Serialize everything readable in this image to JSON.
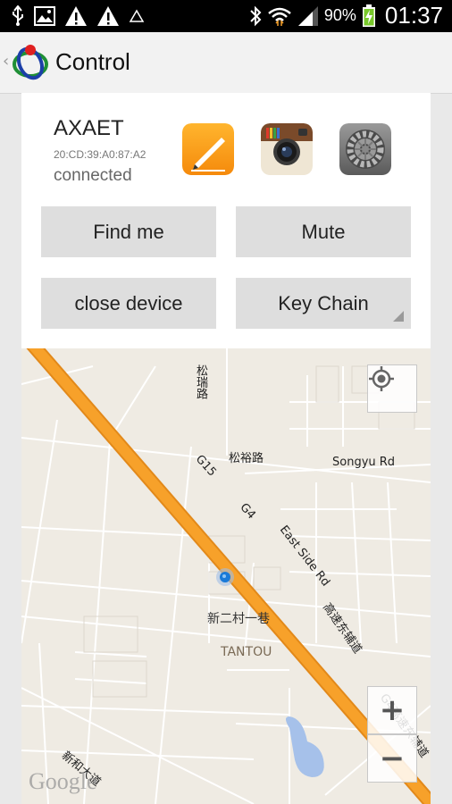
{
  "status_bar": {
    "battery_percent": "90%",
    "time": "01:37",
    "icons": [
      "usb-icon",
      "gallery-icon",
      "warning-icon",
      "warning-icon",
      "warning-outline-icon",
      "bluetooth-icon",
      "wifi-icon",
      "signal-icon",
      "battery-charging-icon"
    ]
  },
  "action_bar": {
    "back_icon": "chevron-left-icon",
    "title": "Control"
  },
  "device": {
    "name": "AXAET",
    "mac": "20:CD:39:A0:87:A2",
    "status": "connected"
  },
  "apps": [
    {
      "name": "pages-icon"
    },
    {
      "name": "camera-app-icon"
    },
    {
      "name": "settings-gear-icon"
    }
  ],
  "buttons": {
    "find_me": "Find me",
    "mute": "Mute",
    "close_device": "close device",
    "key_chain": "Key Chain"
  },
  "map": {
    "labels": {
      "songrui_road": "松瑞路",
      "songyu_road_cn": "松裕路",
      "songyu_road_en": "Songyu Rd",
      "g15": "G15",
      "g4": "G4",
      "east_side_rd": "East Side Rd",
      "expressway_cn": "高速东辅道",
      "xinercun": "新二村一巷",
      "tantou": "TANTOU",
      "g4_lower": "G4高速东辅道",
      "xinhe": "新和大道"
    },
    "zoom_in": "+",
    "zoom_out": "−",
    "attribution": "Google"
  },
  "colors": {
    "highway": "#f7a12a",
    "accent_blue": "#1a7ad8",
    "button_bg": "#dedede",
    "map_bg": "#efebe3"
  }
}
